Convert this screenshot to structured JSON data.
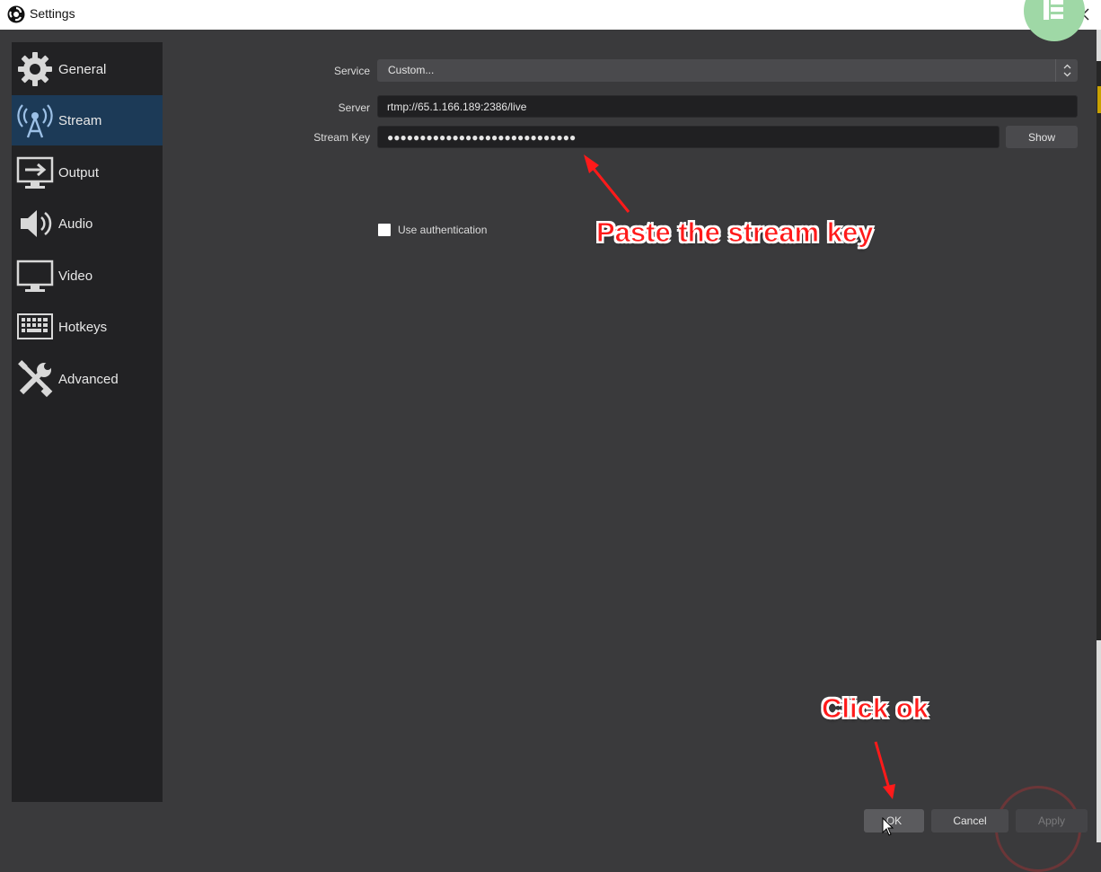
{
  "window": {
    "title": "Settings"
  },
  "sidebar": {
    "items": [
      {
        "label": "General",
        "icon": "gear-icon",
        "active": false
      },
      {
        "label": "Stream",
        "icon": "broadcast-tower-icon",
        "active": true
      },
      {
        "label": "Output",
        "icon": "output-monitor-icon",
        "active": false
      },
      {
        "label": "Audio",
        "icon": "speaker-icon",
        "active": false
      },
      {
        "label": "Video",
        "icon": "monitor-icon",
        "active": false
      },
      {
        "label": "Hotkeys",
        "icon": "keyboard-icon",
        "active": false
      },
      {
        "label": "Advanced",
        "icon": "tools-icon",
        "active": false
      }
    ]
  },
  "form": {
    "service_label": "Service",
    "service_value": "Custom...",
    "server_label": "Server",
    "server_value": "rtmp://65.1.166.189:2386/live",
    "stream_key_label": "Stream Key",
    "stream_key_value": "●●●●●●●●●●●●●●●●●●●●●●●●●●●●●",
    "show_button": "Show",
    "use_auth_label": "Use authentication",
    "use_auth_checked": false
  },
  "annotations": {
    "paste_key": "Paste the stream key",
    "click_ok": "Click ok"
  },
  "buttons": {
    "ok": "OK",
    "cancel": "Cancel",
    "apply": "Apply"
  },
  "colors": {
    "background": "#3a3a3c",
    "sidebar": "#222224",
    "active_item": "#1c3a57",
    "annotation": "#ff1a1a"
  }
}
